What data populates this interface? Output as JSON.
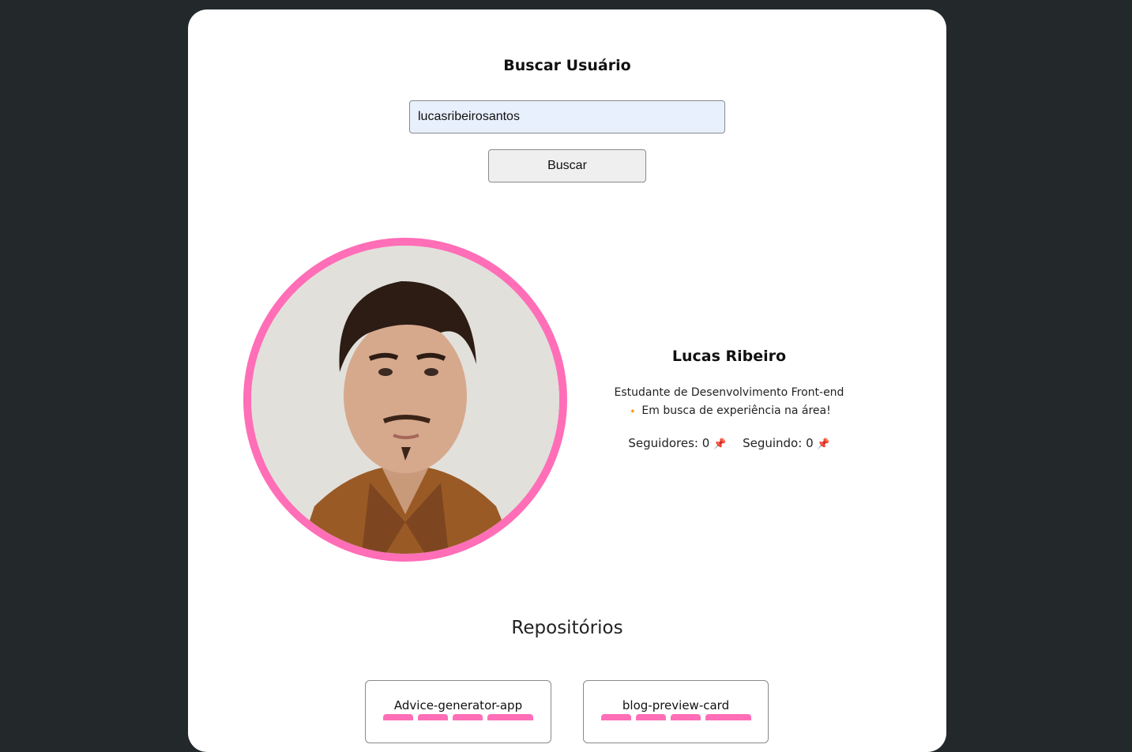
{
  "search": {
    "title": "Buscar Usuário",
    "input_value": "lucasribeirosantos",
    "button_label": "Buscar"
  },
  "profile": {
    "name": "Lucas Ribeiro",
    "bio_line1": "Estudante de Desenvolvimento Front-end",
    "bio_icon": "🔸",
    "bio_line2": "Em busca de experiência na área!",
    "followers_label": "Seguidores:",
    "followers": "0",
    "following_label": "Seguindo:",
    "following": "0",
    "stat_icon": "📌"
  },
  "repos": {
    "title": "Repositórios",
    "items": [
      {
        "name": "Advice-generator-app"
      },
      {
        "name": "blog-preview-card"
      }
    ]
  },
  "colors": {
    "background": "#23282b",
    "card": "#ffffff",
    "accent": "#ff6eb7",
    "input_bg": "#e8f0fe"
  }
}
